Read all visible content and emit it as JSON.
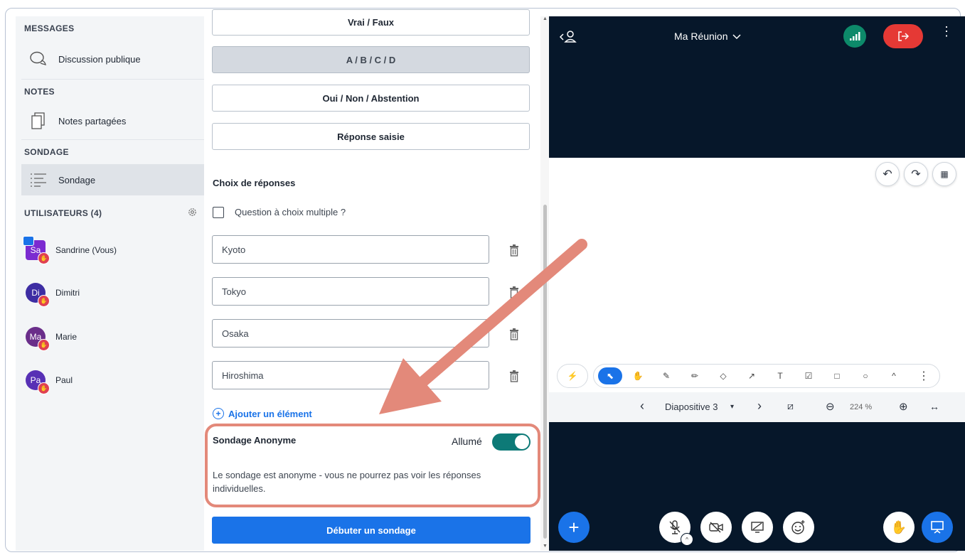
{
  "sidebar": {
    "messages_title": "MESSAGES",
    "public_chat": "Discussion publique",
    "notes_title": "NOTES",
    "shared_notes": "Notes partagées",
    "poll_title": "SONDAGE",
    "poll_item": "Sondage",
    "users_title": "UTILISATEURS (4)",
    "users": [
      {
        "initials": "Sa",
        "name": "Sandrine (Vous)",
        "color": "#7b2bd0"
      },
      {
        "initials": "Di",
        "name": "Dimitri",
        "color": "#3d2da3"
      },
      {
        "initials": "Ma",
        "name": "Marie",
        "color": "#6a2e8a"
      },
      {
        "initials": "Pa",
        "name": "Paul",
        "color": "#5730b5"
      }
    ]
  },
  "poll": {
    "types": [
      "Vrai / Faux",
      "A / B / C / D",
      "Oui / Non / Abstention",
      "Réponse saisie"
    ],
    "choices_title": "Choix de réponses",
    "multiple_choice_label": "Question à choix multiple ?",
    "answers": [
      "Kyoto",
      "Tokyo",
      "Osaka",
      "Hiroshima"
    ],
    "add_item": "Ajouter un élément",
    "anonymous_title": "Sondage Anonyme",
    "anonymous_state": "Allumé",
    "anonymous_desc": "Le sondage est anonyme - vous ne pourrez pas voir les réponses individuelles.",
    "start_button": "Débuter un sondage"
  },
  "meeting": {
    "title": "Ma Réunion",
    "slide_label": "Diapositive 3",
    "zoom": "224 %"
  },
  "colors": {
    "accent": "#1a73e8",
    "toggle_on": "#0d7a77",
    "leave": "#e53935",
    "highlight": "#e3897a",
    "meeting_bg": "#06172a"
  }
}
